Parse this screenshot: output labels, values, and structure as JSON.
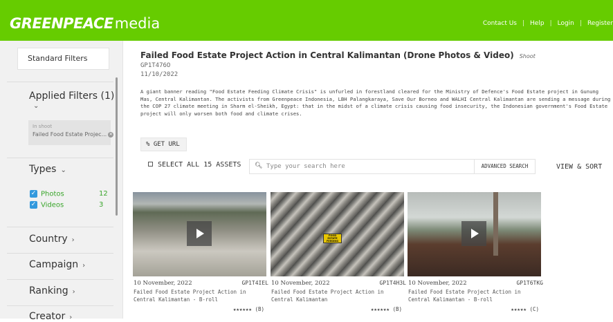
{
  "header": {
    "logo_brand": "GREENPEACE",
    "logo_media": "media",
    "nav": [
      "Contact Us",
      "Help",
      "Login",
      "Register"
    ],
    "bg_color": "#66cc00"
  },
  "sidebar": {
    "standard_filters": "Standard Filters",
    "applied_filters": "Applied Filters (1)",
    "chip_label": "In shoot",
    "chip_value": "Failed Food Estate Projec...",
    "types": "Types",
    "type_items": [
      {
        "label": "Photos",
        "count": "12"
      },
      {
        "label": "Videos",
        "count": "3"
      }
    ],
    "country": "Country",
    "campaign": "Campaign",
    "ranking": "Ranking",
    "creator": "Creator"
  },
  "shoot": {
    "title": "Failed Food Estate Project Action in Central Kalimantan (Drone Photos & Video)",
    "tag": "Shoot",
    "code": "GP1T476O",
    "date": "11/10/2022",
    "description": "A giant banner reading \"Food Estate Feeding Climate Crisis\" is unfurled in forestland cleared for the Ministry of Defence's Food Estate project in Gunung Mas, Central Kalimantan. The activists from Greenpeace Indonesia, LBH Palangkaraya, Save Our Borneo and WALHI Central Kalimantan are sending a message during the COP 27 climate meeting in Sharm el-Sheikh, Egypt: that in the midst of a climate crisis causing food insecurity, the Indonesian government's Food Estate project will only worsen both food and climate crises."
  },
  "toolbar": {
    "get_url": "GET URL",
    "select_all": "SELECT ALL 15 ASSETS",
    "search_placeholder": "Type your search here",
    "advanced_search": "ADVANCED SEARCH",
    "view_sort": "VIEW & SORT"
  },
  "assets": [
    {
      "date": "10 November, 2022",
      "code": "GP1T4IEL",
      "title": "Failed Food Estate Project Action in Central Kalimantan - B-roll",
      "rating": "★★★★★★ (B)"
    },
    {
      "date": "10 November, 2022",
      "code": "GP1T4H3L",
      "title": "Failed Food Estate Project Action in Central Kalimantan",
      "rating": "★★★★★★ (B)",
      "banner_text": "FOOD ESTATE FEEDING CLIMATE CRISIS"
    },
    {
      "date": "10 November, 2022",
      "code": "GP1T6TKG",
      "title": "Failed Food Estate Project Action in Central Kalimantan - B-roll",
      "rating": "★★★★★ (C)"
    }
  ]
}
